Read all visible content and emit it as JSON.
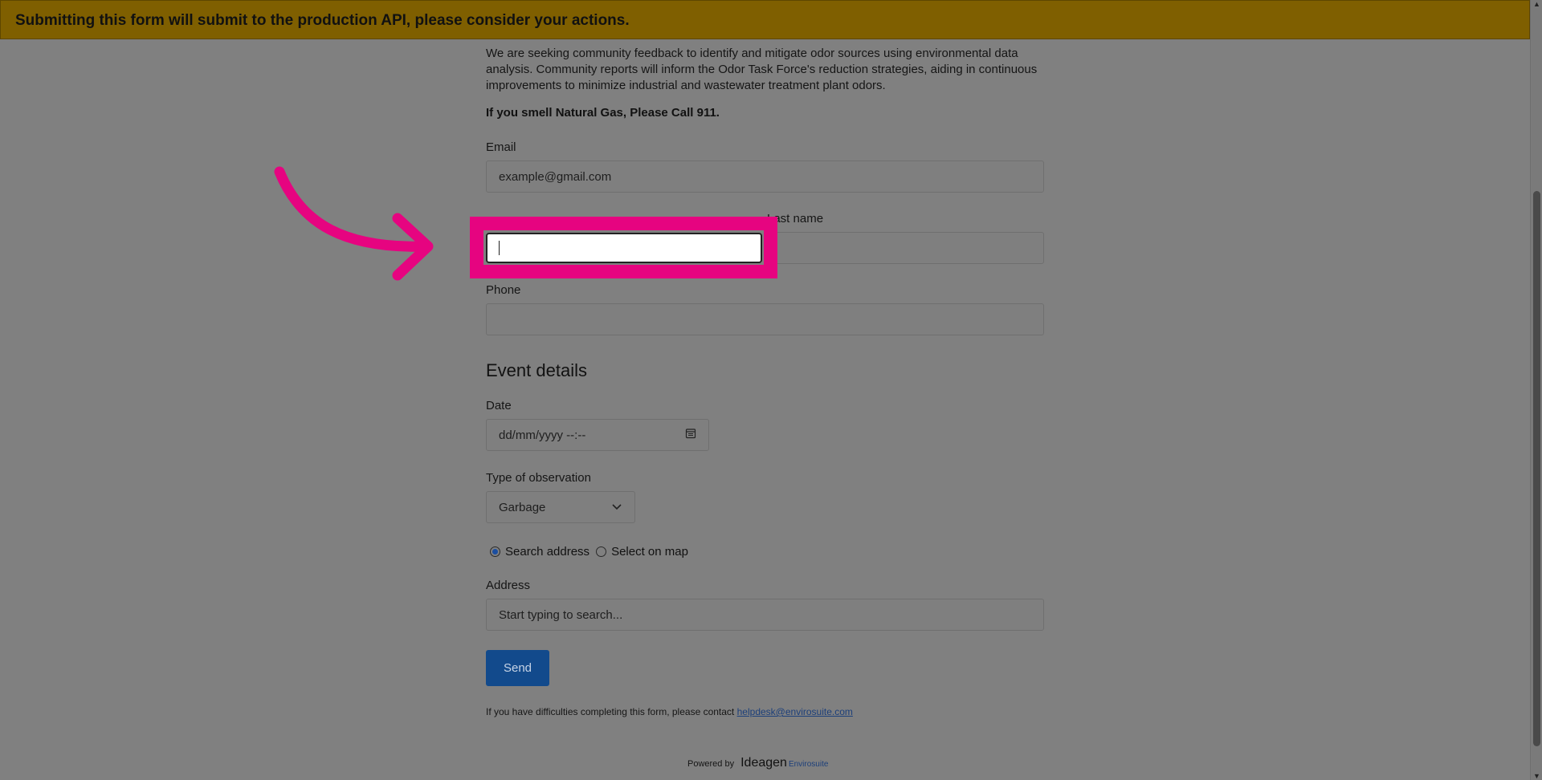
{
  "banner": {
    "text": "Submitting this form will submit to the production API, please consider your actions."
  },
  "intro": {
    "paragraph": "We are seeking community feedback to identify and mitigate odor sources using environmental data analysis. Community reports will inform the Odor Task Force's reduction strategies, aiding in continuous improvements to minimize industrial and wastewater treatment plant odors.",
    "gas_warning": "If you smell Natural Gas, Please Call 911."
  },
  "form": {
    "email_label": "Email",
    "email_placeholder": "example@gmail.com",
    "last_name_label": "Last name",
    "phone_label": "Phone",
    "event_heading": "Event details",
    "date_label": "Date",
    "date_placeholder": "dd/mm/yyyy --:--",
    "observation_label": "Type of observation",
    "observation_value": "Garbage",
    "radio_search": "Search address",
    "radio_map": "Select on map",
    "address_label": "Address",
    "address_placeholder": "Start typing to search...",
    "send_label": "Send"
  },
  "footer": {
    "help_text": "If you have difficulties completing this form, please contact",
    "help_email": "helpdesk@envirosuite.com",
    "powered_by": "Powered by",
    "brand": "Ideagen",
    "brand_sub": "Envirosuite"
  },
  "colors": {
    "highlight": "#e60480",
    "banner": "#7f5f00",
    "send": "#124a8c"
  },
  "icons": {
    "calendar": "calendar-icon",
    "chevron": "chevron-down-icon",
    "arrow": "annotation-arrow-icon"
  }
}
